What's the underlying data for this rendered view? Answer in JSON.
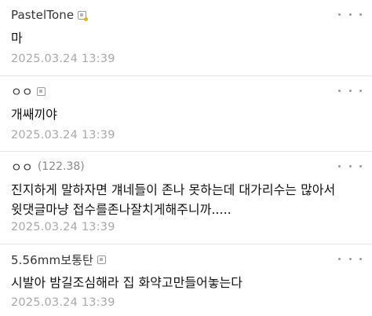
{
  "comments": [
    {
      "author": "PastelTone",
      "ip": "",
      "body": "마",
      "date": "2025.03.24 13:39",
      "badge_icon": "gold-member-icon"
    },
    {
      "author": "ㅇㅇ",
      "ip": "",
      "body": "개쌔끼야",
      "date": "2025.03.24 13:39",
      "badge_icon": "member-icon"
    },
    {
      "author": "ㅇㅇ",
      "ip": "(122.38)",
      "body": "진지하게 말하자면 걔네들이 존나 못하는데 대가리수는 많아서\n윗댓글마냥 접수를존나잘치게해주니까.....",
      "date": "2025.03.24 13:39",
      "badge_icon": ""
    },
    {
      "author": "5.56mm보통탄",
      "ip": "",
      "body": "시발아 밤길조심해라 집 화약고만들어놓는다",
      "date": "2025.03.24 13:39",
      "badge_icon": "member-icon"
    }
  ],
  "colors": {
    "author": "#333333",
    "body": "#111111",
    "date": "#a8a8a8",
    "divider": "#e6e6e6",
    "more_dots": "#9a9a9a"
  },
  "icons": {
    "more": "more-options-icon"
  }
}
